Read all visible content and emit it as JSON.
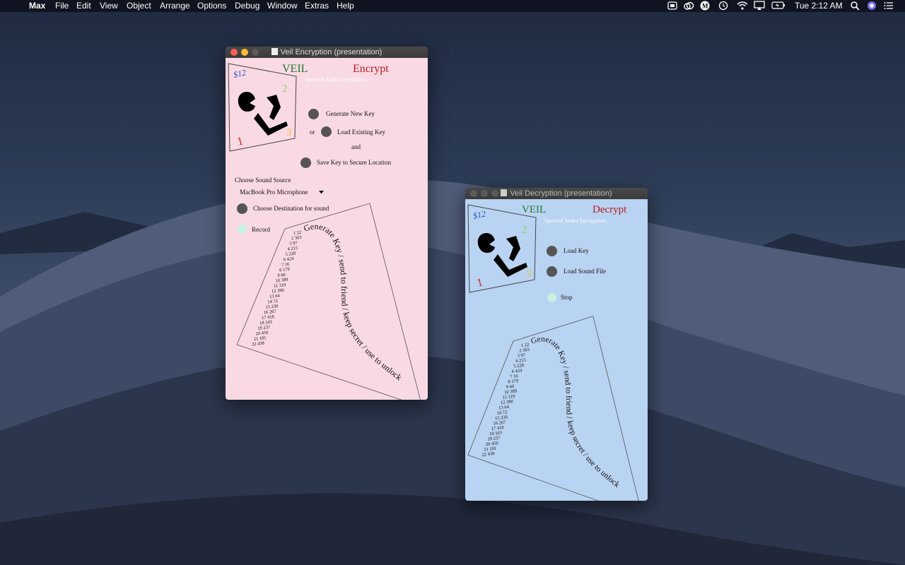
{
  "menubar": {
    "apple_glyph": "",
    "app_name": "Max",
    "items": [
      "File",
      "Edit",
      "View",
      "Object",
      "Arrange",
      "Options",
      "Debug",
      "Window",
      "Extras",
      "Help"
    ],
    "clock": "Tue 2:12 AM"
  },
  "colors": {
    "encrypt_bg": "#f9d9e4",
    "decrypt_bg": "#b9d3f2",
    "veil_green": "#1e7a2a",
    "action_red": "#b81b1b",
    "button_gray": "#555555",
    "record_mint": "#c6f2df"
  },
  "encrypt_window": {
    "title": "Veil Encryption (presentation)",
    "veil": "VEIL",
    "mode": "Encrypt",
    "subtitle": "Spectral Audio Encryption...",
    "buttons": {
      "generate": "Generate New Key",
      "or": "or",
      "load_existing": "Load Existing Key",
      "and": "and",
      "save_key": "Save Key to Secure Location"
    },
    "sound_source_label": "Choose Sound Source",
    "sound_source_value": "MacBook Pro Microphone",
    "destination": "Choose Destination for sound",
    "record": "Record",
    "logo": {
      "corner_text": "$12",
      "num1": "1",
      "num2": "2",
      "num3": "3"
    }
  },
  "decrypt_window": {
    "title": "Veil Decryption (presentation)",
    "veil": "VEIL",
    "mode": "Decrypt",
    "subtitle": "Spectral Audio Encryption...",
    "buttons": {
      "load_key": "Load Key",
      "load_sound": "Load Sound File",
      "stop": "Stop"
    },
    "logo": {
      "corner_text": "$12",
      "num1": "1",
      "num2": "2",
      "num3": "3"
    }
  },
  "key_diagram": {
    "curve_text": "Generate Key / send to friend / keep secret / use to unlock",
    "entries": [
      "1 22",
      "2 303",
      "3 97",
      "4 215",
      "5 228",
      "6 424",
      "7 16",
      "8 179",
      "9 60",
      "10 389",
      "11 319",
      "12 380",
      "13 64",
      "14 72",
      "15 230",
      "16 267",
      "17 418",
      "18 103",
      "19 237",
      "20 450",
      "21 181",
      "22 438"
    ]
  }
}
